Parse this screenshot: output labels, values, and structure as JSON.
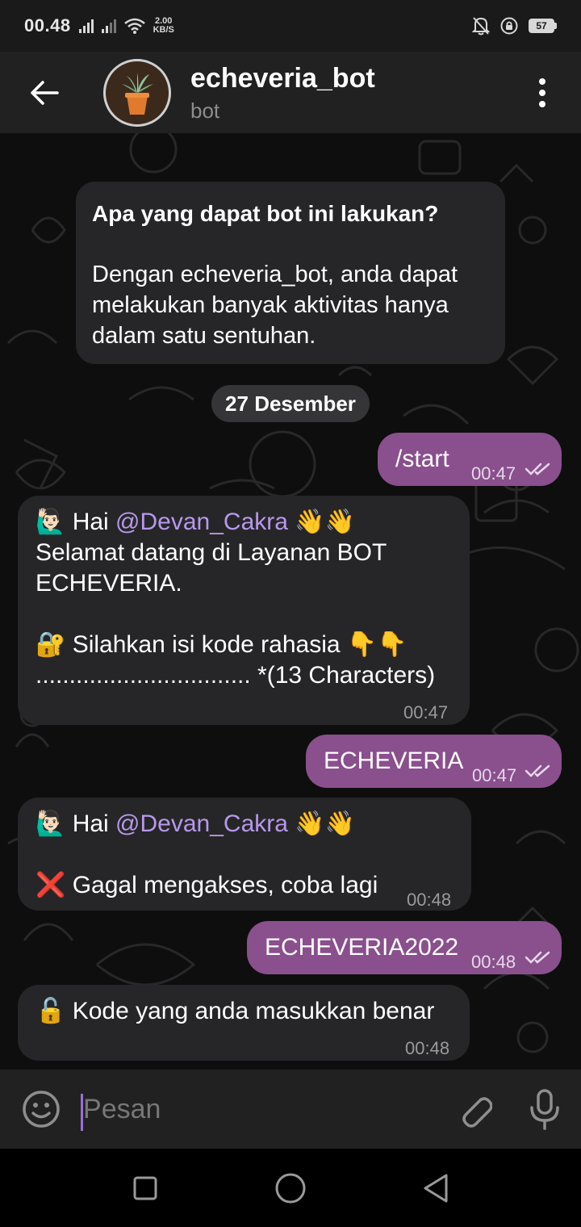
{
  "status_bar": {
    "time": "00.48",
    "net_speed_value": "2.00",
    "net_speed_unit": "KB/S",
    "battery": "57"
  },
  "header": {
    "title": "echeveria_bot",
    "subtitle": "bot"
  },
  "intro": {
    "title": "Apa yang dapat bot ini lakukan?",
    "body": "Dengan echeveria_bot, anda dapat melakukan banyak aktivitas hanya dalam satu sentuhan."
  },
  "date_separator": "27 Desember",
  "messages": [
    {
      "id": "m1",
      "direction": "out",
      "text": "/start",
      "time": "00:47"
    },
    {
      "id": "m2",
      "direction": "in",
      "line1_prefix": "🙋🏻‍♂️ Hai ",
      "mention": "@Devan_Cakra",
      "line1_suffix": " 👋👋",
      "line2": "Selamat datang di Layanan BOT",
      "line3": "ECHEVERIA.",
      "line4": "🔐 Silahkan isi kode rahasia  👇👇",
      "line5": "................................ *(13 Characters)",
      "time": "00:47"
    },
    {
      "id": "m3",
      "direction": "out",
      "text": "ECHEVERIA",
      "time": "00:47"
    },
    {
      "id": "m4",
      "direction": "in",
      "line1_prefix": "🙋🏻‍♂️ Hai ",
      "mention": "@Devan_Cakra",
      "line1_suffix": " 👋👋",
      "line2": "❌ Gagal mengakses, coba lagi",
      "time": "00:48"
    },
    {
      "id": "m5",
      "direction": "out",
      "text": "ECHEVERIA2022",
      "time": "00:48"
    },
    {
      "id": "m6",
      "direction": "in",
      "text": "🔓 Kode yang anda masukkan benar",
      "time": "00:48"
    }
  ],
  "input": {
    "placeholder": "Pesan"
  },
  "colors": {
    "header_bg": "#212121",
    "incoming_bubble": "#262628",
    "outgoing_bubble": "#8a4f8d",
    "mention": "#b898ea",
    "accent": "#9a6fd6"
  },
  "icons": {
    "back": "arrow-left-icon",
    "menu": "more-vertical-icon",
    "emoji": "smiley-icon",
    "attach": "paperclip-icon",
    "mic": "microphone-icon",
    "read": "double-check-icon"
  }
}
